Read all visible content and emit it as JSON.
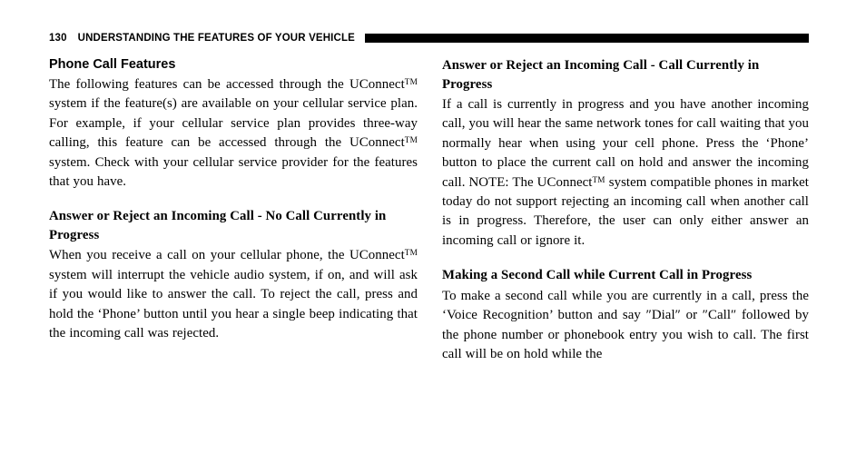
{
  "header": {
    "page_number": "130",
    "title": "UNDERSTANDING THE FEATURES OF YOUR VEHICLE",
    "rule_color": "#000000"
  },
  "trademark": "TM",
  "left_column": {
    "section_1": {
      "heading": "Phone Call Features",
      "body_before_tm": "The following features can be accessed through the UConnect",
      "body_after_tm": " system if the feature(s) are available on your cellular service plan. For example, if your cellular service plan provides three-way calling, this feature can be accessed through the UConnect",
      "body_tail": " system. Check with your cellular service provider for the features that you have."
    },
    "section_2": {
      "heading": "Answer or Reject an Incoming Call - No Call Currently in Progress",
      "body_before_tm": "When you receive a call on your cellular phone, the UConnect",
      "body_after_tm": " system will interrupt the vehicle audio system, if on, and will ask if you would like to answer the call. To reject the call, press and hold the ‘Phone’ button until you hear a single beep indicating that the incoming call was rejected."
    }
  },
  "right_column": {
    "section_1": {
      "heading": "Answer or Reject an Incoming Call - Call Currently in Progress",
      "body_before_tm": "If a call is currently in progress and you have another incoming call, you will hear the same network tones for call waiting that you normally hear when using your cell phone. Press the ‘Phone’ button to place the current call on hold and answer the incoming call. NOTE: The UConnect",
      "body_after_tm": " system compatible phones in market today do not support rejecting an incoming call when another call is in progress. Therefore, the user can only either answer an incoming call or ignore it."
    },
    "section_2": {
      "heading": "Making a Second Call while Current Call in Progress",
      "body": "To make a second call while you are currently in a call, press the ‘Voice Recognition’ button and say ″Dial″ or ″Call″ followed by the phone number or phonebook entry you wish to call. The first call will be on hold while the"
    }
  }
}
